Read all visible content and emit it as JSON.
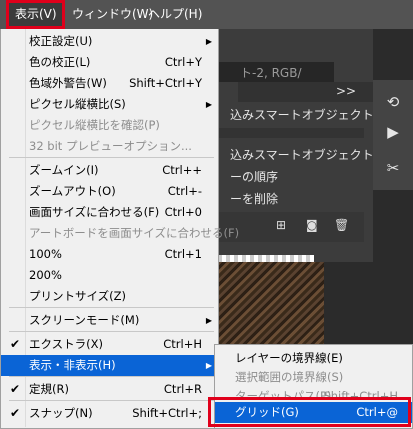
{
  "menubar": {
    "view": "表示(V)",
    "window": "ウィンドウ(W)",
    "help": "ヘルプ(H)"
  },
  "background": {
    "layers_tab": ">>",
    "row1": "込みスマートオブジェクトを再",
    "row2": "込みスマートオブジェクトを再",
    "row3": "ーの順序",
    "row4": "ーを削除",
    "tab_frag": "ト-2, RGB/"
  },
  "view_menu": {
    "items": [
      {
        "label": "校正設定(U)",
        "shortcut": "",
        "submenu": true
      },
      {
        "label": "色の校正(L)",
        "shortcut": "Ctrl+Y"
      },
      {
        "label": "色域外警告(W)",
        "shortcut": "Shift+Ctrl+Y"
      },
      {
        "label": "ピクセル縦横比(S)",
        "shortcut": "",
        "submenu": true
      },
      {
        "label": "ピクセル縦横比を確認(P)",
        "shortcut": "",
        "disabled": true
      },
      {
        "label": "32 bit プレビューオプション...",
        "shortcut": "",
        "disabled": true
      },
      {
        "label": "ズームイン(I)",
        "shortcut": "Ctrl++"
      },
      {
        "label": "ズームアウト(O)",
        "shortcut": "Ctrl+-"
      },
      {
        "label": "画面サイズに合わせる(F)",
        "shortcut": "Ctrl+0"
      },
      {
        "label": "アートボードを画面サイズに合わせる(F)",
        "shortcut": "",
        "disabled": true
      },
      {
        "label": "100%",
        "shortcut": "Ctrl+1"
      },
      {
        "label": "200%",
        "shortcut": ""
      },
      {
        "label": "プリントサイズ(Z)",
        "shortcut": ""
      },
      {
        "label": "スクリーンモード(M)",
        "shortcut": "",
        "submenu": true
      },
      {
        "label": "エクストラ(X)",
        "shortcut": "Ctrl+H",
        "checked": true
      },
      {
        "label": "表示・非表示(H)",
        "shortcut": "",
        "submenu": true,
        "highlighted": true
      },
      {
        "label": "定規(R)",
        "shortcut": "Ctrl+R",
        "checked": true
      },
      {
        "label": "スナップ(N)",
        "shortcut": "Shift+Ctrl+;",
        "checked": true
      }
    ],
    "check_glyph": "✔",
    "arrow_glyph": "▶"
  },
  "show_submenu": {
    "items": [
      {
        "label": "レイヤーの境界線(E)",
        "shortcut": ""
      },
      {
        "label": "選択範囲の境界線(S)",
        "shortcut": "",
        "disabled": true
      },
      {
        "label": "ターゲットパス(P)",
        "shortcut": "Shift+Ctrl+H",
        "disabled": true
      },
      {
        "label": "グリッド(G)",
        "shortcut": "Ctrl+@",
        "highlighted": true
      }
    ]
  },
  "colors": {
    "highlight": "#0a64d6",
    "annotation_red": "#e0001b"
  }
}
